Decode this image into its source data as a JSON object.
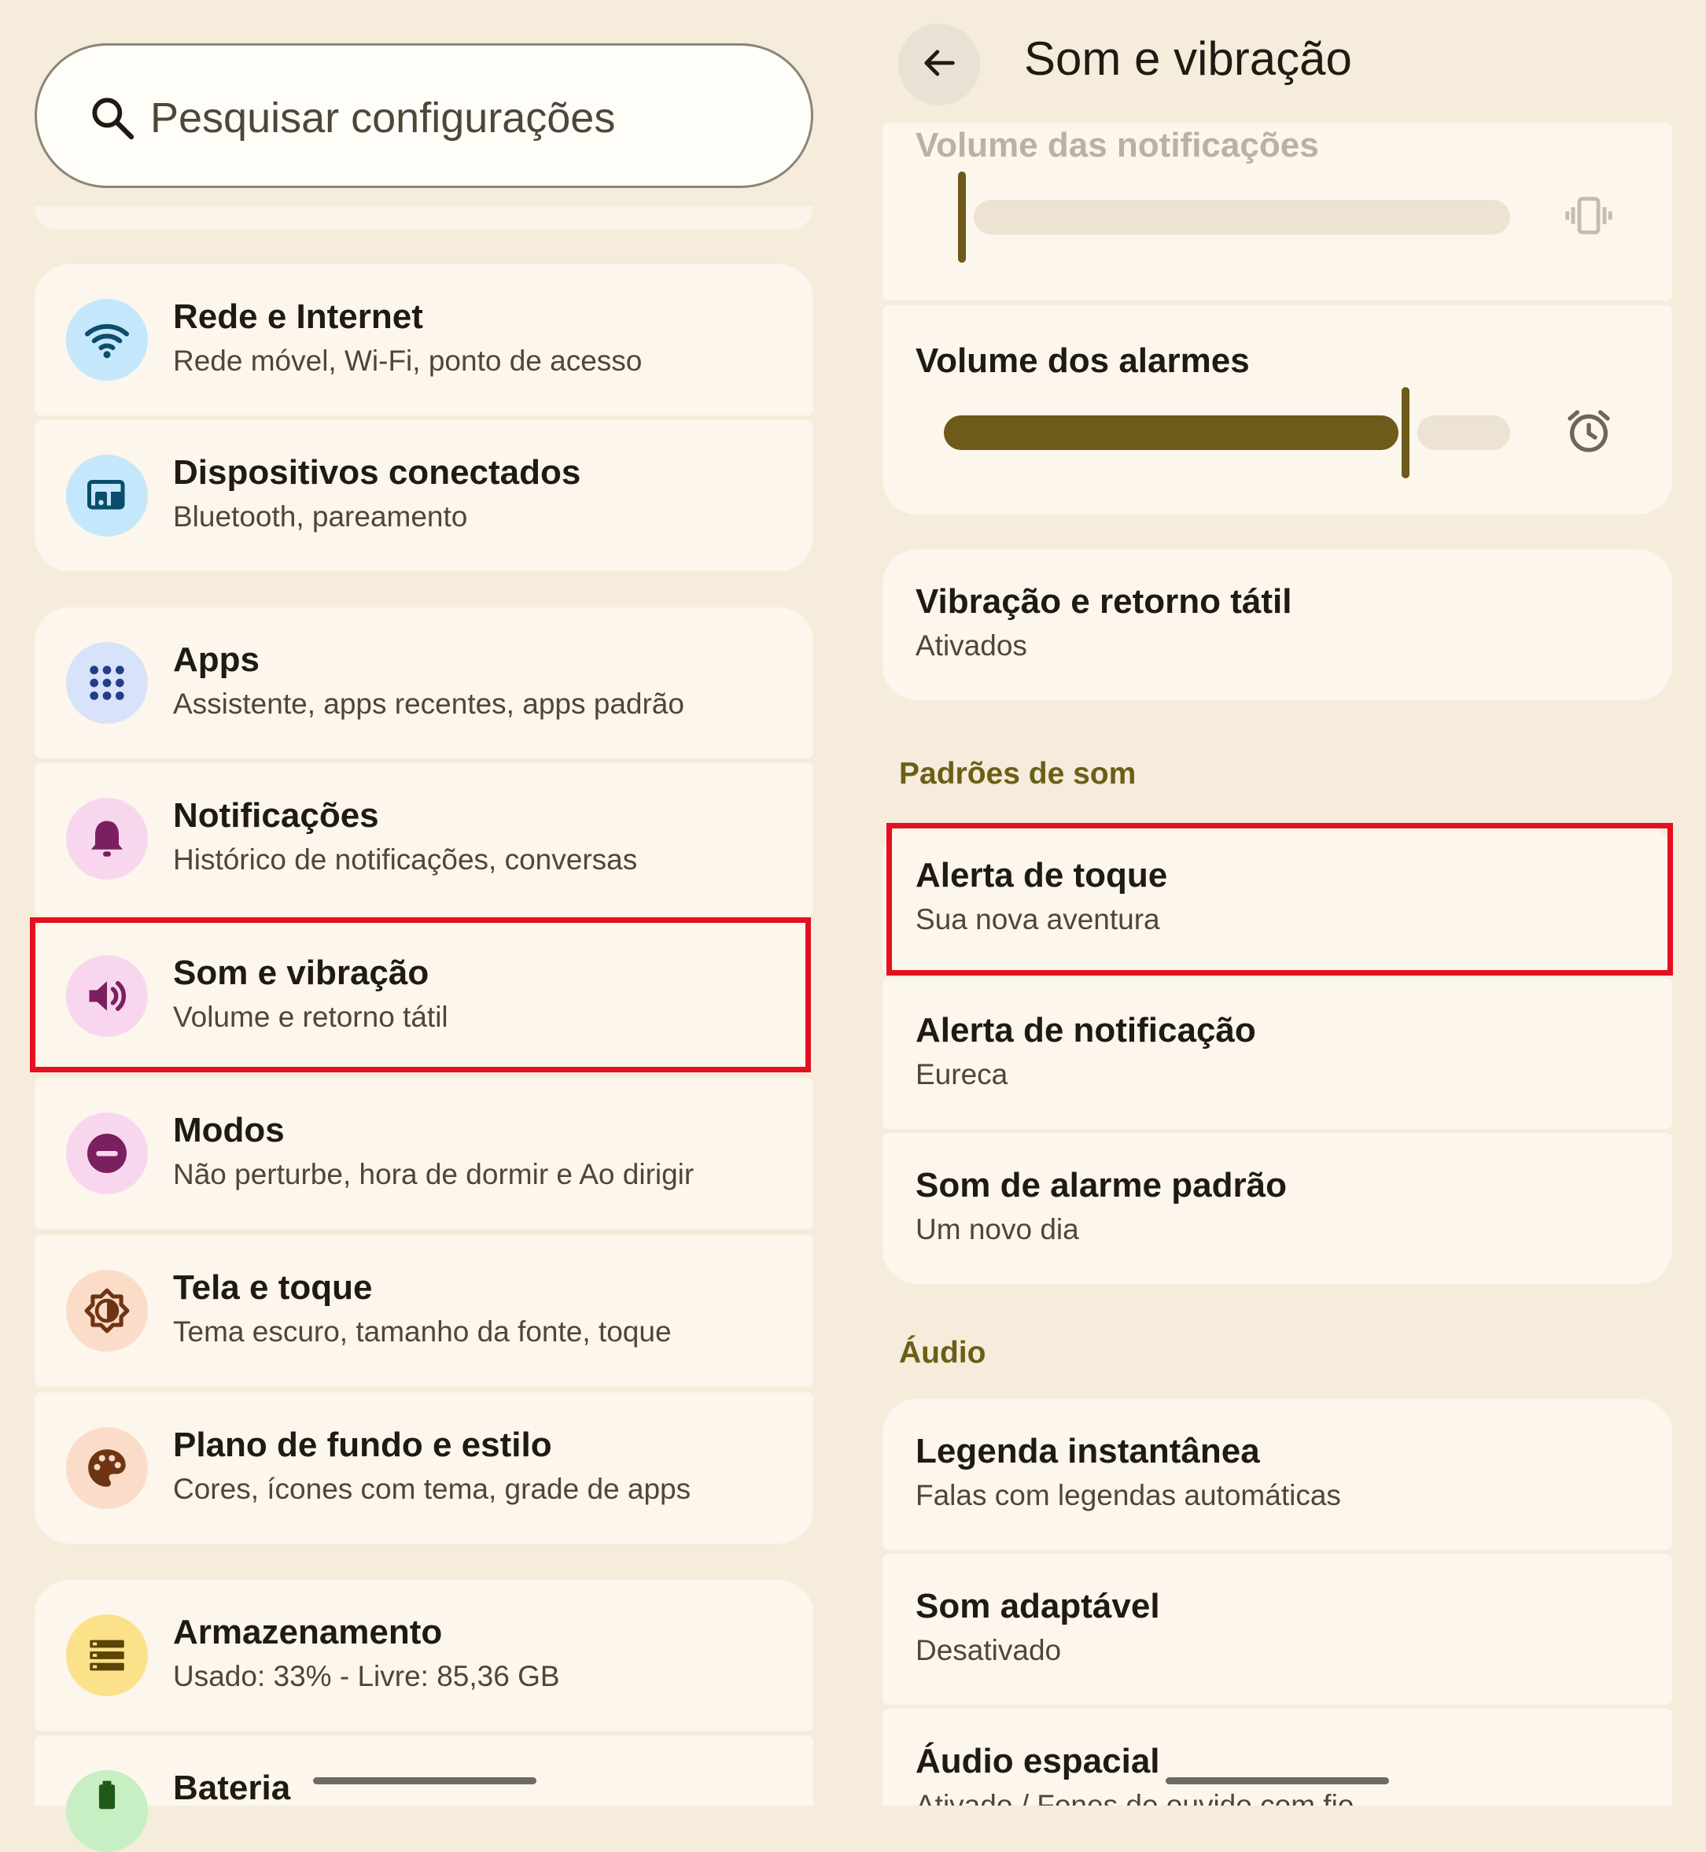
{
  "search": {
    "placeholder": "Pesquisar configurações"
  },
  "settings_list": [
    {
      "title": "Rede e Internet",
      "subtitle": "Rede móvel, Wi-Fi, ponto de acesso",
      "icon": "wifi-icon",
      "icon_bg": "#c4e7fb",
      "icon_fg": "#0b4d6b"
    },
    {
      "title": "Dispositivos conectados",
      "subtitle": "Bluetooth, pareamento",
      "icon": "connected-devices-icon",
      "icon_bg": "#c4e7fb",
      "icon_fg": "#0b4d6b"
    },
    {
      "title": "Apps",
      "subtitle": "Assistente, apps recentes, apps padrão",
      "icon": "apps-grid-icon",
      "icon_bg": "#d8e2fb",
      "icon_fg": "#243d88"
    },
    {
      "title": "Notificações",
      "subtitle": "Histórico de notificações, conversas",
      "icon": "bell-icon",
      "icon_bg": "#f8d7ee",
      "icon_fg": "#7c1f5e"
    },
    {
      "title": "Som e vibração",
      "subtitle": "Volume e retorno tátil",
      "icon": "speaker-icon",
      "icon_bg": "#f8d7ee",
      "icon_fg": "#7c1f5e"
    },
    {
      "title": "Modos",
      "subtitle": "Não perturbe, hora de dormir e Ao dirigir",
      "icon": "do-not-disturb-icon",
      "icon_bg": "#f8d7ee",
      "icon_fg": "#7c1f5e"
    },
    {
      "title": "Tela e toque",
      "subtitle": "Tema escuro, tamanho da fonte, toque",
      "icon": "brightness-icon",
      "icon_bg": "#fbdcc8",
      "icon_fg": "#6e3514"
    },
    {
      "title": "Plano de fundo e estilo",
      "subtitle": "Cores, ícones com tema, grade de apps",
      "icon": "palette-icon",
      "icon_bg": "#fbdcc8",
      "icon_fg": "#6e3514"
    },
    {
      "title": "Armazenamento",
      "subtitle": "Usado: 33% - Livre: 85,36 GB",
      "icon": "storage-icon",
      "icon_bg": "#fbe18a",
      "icon_fg": "#5a4505"
    },
    {
      "title": "Bateria",
      "subtitle": "",
      "icon": "battery-icon",
      "icon_bg": "#c8efc4",
      "icon_fg": "#1f5a1a"
    }
  ],
  "detail": {
    "back_icon": "arrow-back-icon",
    "title": "Som e vibração",
    "notification_volume": {
      "label": "Volume das notificações",
      "level": 0,
      "icon": "vibrate-icon"
    },
    "alarm_volume": {
      "label": "Volume dos alarmes",
      "level": 0.81,
      "icon": "alarm-clock-icon"
    },
    "vibration": {
      "title": "Vibração e retorno tátil",
      "subtitle": "Ativados"
    },
    "sound_patterns_header": "Padrões de som",
    "sound_patterns": [
      {
        "title": "Alerta de toque",
        "subtitle": "Sua nova aventura"
      },
      {
        "title": "Alerta de notificação",
        "subtitle": "Eureca"
      },
      {
        "title": "Som de alarme padrão",
        "subtitle": "Um novo dia"
      }
    ],
    "audio_header": "Áudio",
    "audio": [
      {
        "title": "Legenda instantânea",
        "subtitle": "Falas com legendas automáticas"
      },
      {
        "title": "Som adaptável",
        "subtitle": "Desativado"
      },
      {
        "title": "Áudio espacial",
        "subtitle": "Ativado / Fones de ouvido com fio"
      }
    ]
  },
  "colors": {
    "background": "#f5ecdc",
    "card": "#fcf6ec",
    "accent": "#6e5a1a",
    "highlight": "#e3101f"
  }
}
